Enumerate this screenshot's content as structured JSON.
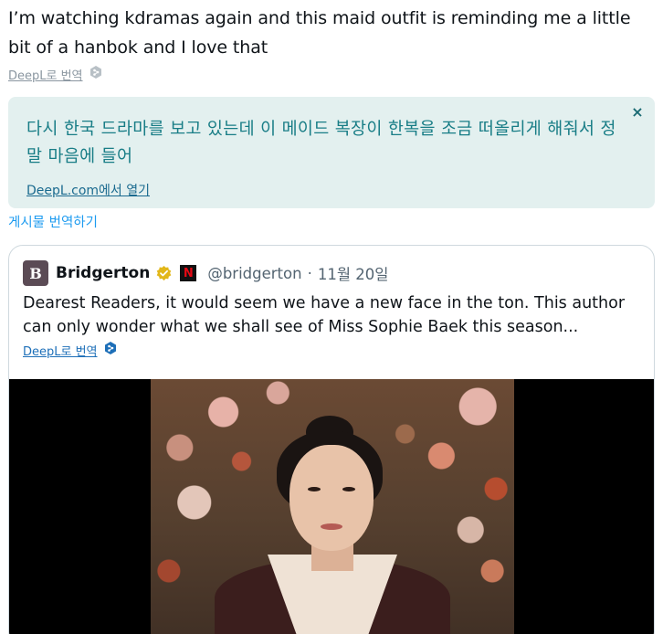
{
  "tweet": {
    "text": "I’m watching kdramas again and this maid outfit is reminding me a little bit of a hanbok and I love that",
    "deepl_link": "DeepL로 번역"
  },
  "translation": {
    "text": "다시 한국 드라마를 보고 있는데 이 메이드 복장이 한복을 조금 떠올리게 해줘서 정말 마음에 들어",
    "open_link": "DeepL.com에서 열기",
    "close_label": "×"
  },
  "translate_post": "게시물 번역하기",
  "quote": {
    "avatar_letter": "B",
    "name": "Bridgerton",
    "netflix_label": "N",
    "handle": "@bridgerton",
    "separator": "·",
    "date": "11월 20일",
    "text": "Dearest Readers, it would seem we have a new face in the ton. This author can only wonder what we shall see of Miss Sophie Baek this season...",
    "deepl_link": "DeepL로 번역"
  },
  "icons": {
    "deepl": "deepl-icon",
    "verified": "verified-badge-icon",
    "netflix": "netflix-logo-icon",
    "close": "close-icon"
  },
  "colors": {
    "translation_bg": "#e3f0ef",
    "translation_text": "#187d86",
    "link_blue": "#1d9bf0",
    "verified_gold": "#e2b719"
  }
}
